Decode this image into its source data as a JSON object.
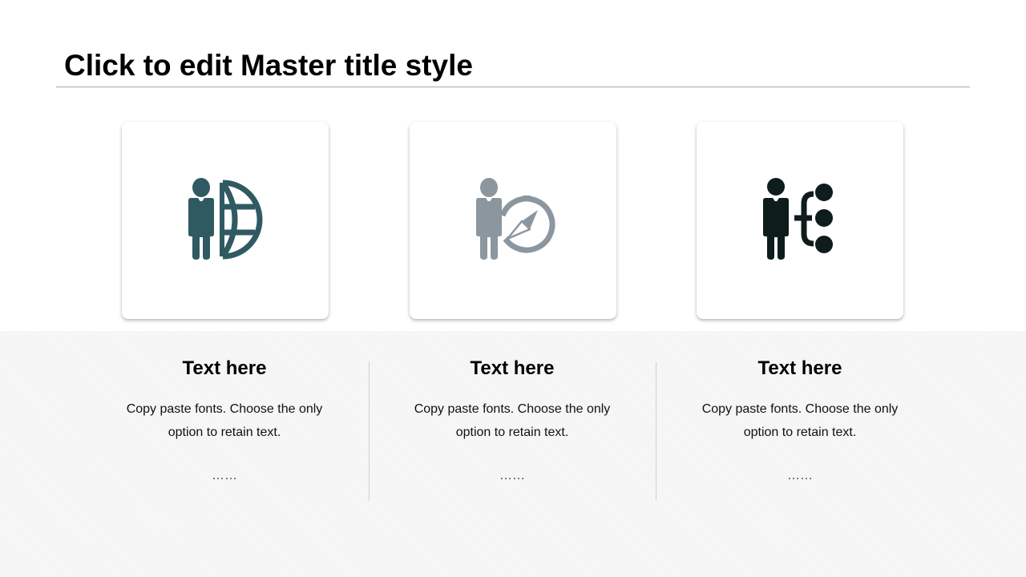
{
  "slide": {
    "title": "Click to edit Master title style"
  },
  "colors": {
    "teal": "#2f5a62",
    "gray": "#8c969e",
    "dark": "#0f1c1c"
  },
  "cards": [
    {
      "icon": "businessman-globe-icon",
      "color": "#2f5a62"
    },
    {
      "icon": "businessman-compass-icon",
      "color": "#8c969e"
    },
    {
      "icon": "businessman-hierarchy-icon",
      "color": "#0f1c1c"
    }
  ],
  "columns": [
    {
      "heading": "Text here",
      "body": "Copy paste fonts. Choose the only option to retain text.",
      "dots": "……"
    },
    {
      "heading": "Text here",
      "body": "Copy paste fonts. Choose the only option to retain text.",
      "dots": "……"
    },
    {
      "heading": "Text here",
      "body": "Copy paste fonts. Choose the only option to retain text.",
      "dots": "……"
    }
  ]
}
